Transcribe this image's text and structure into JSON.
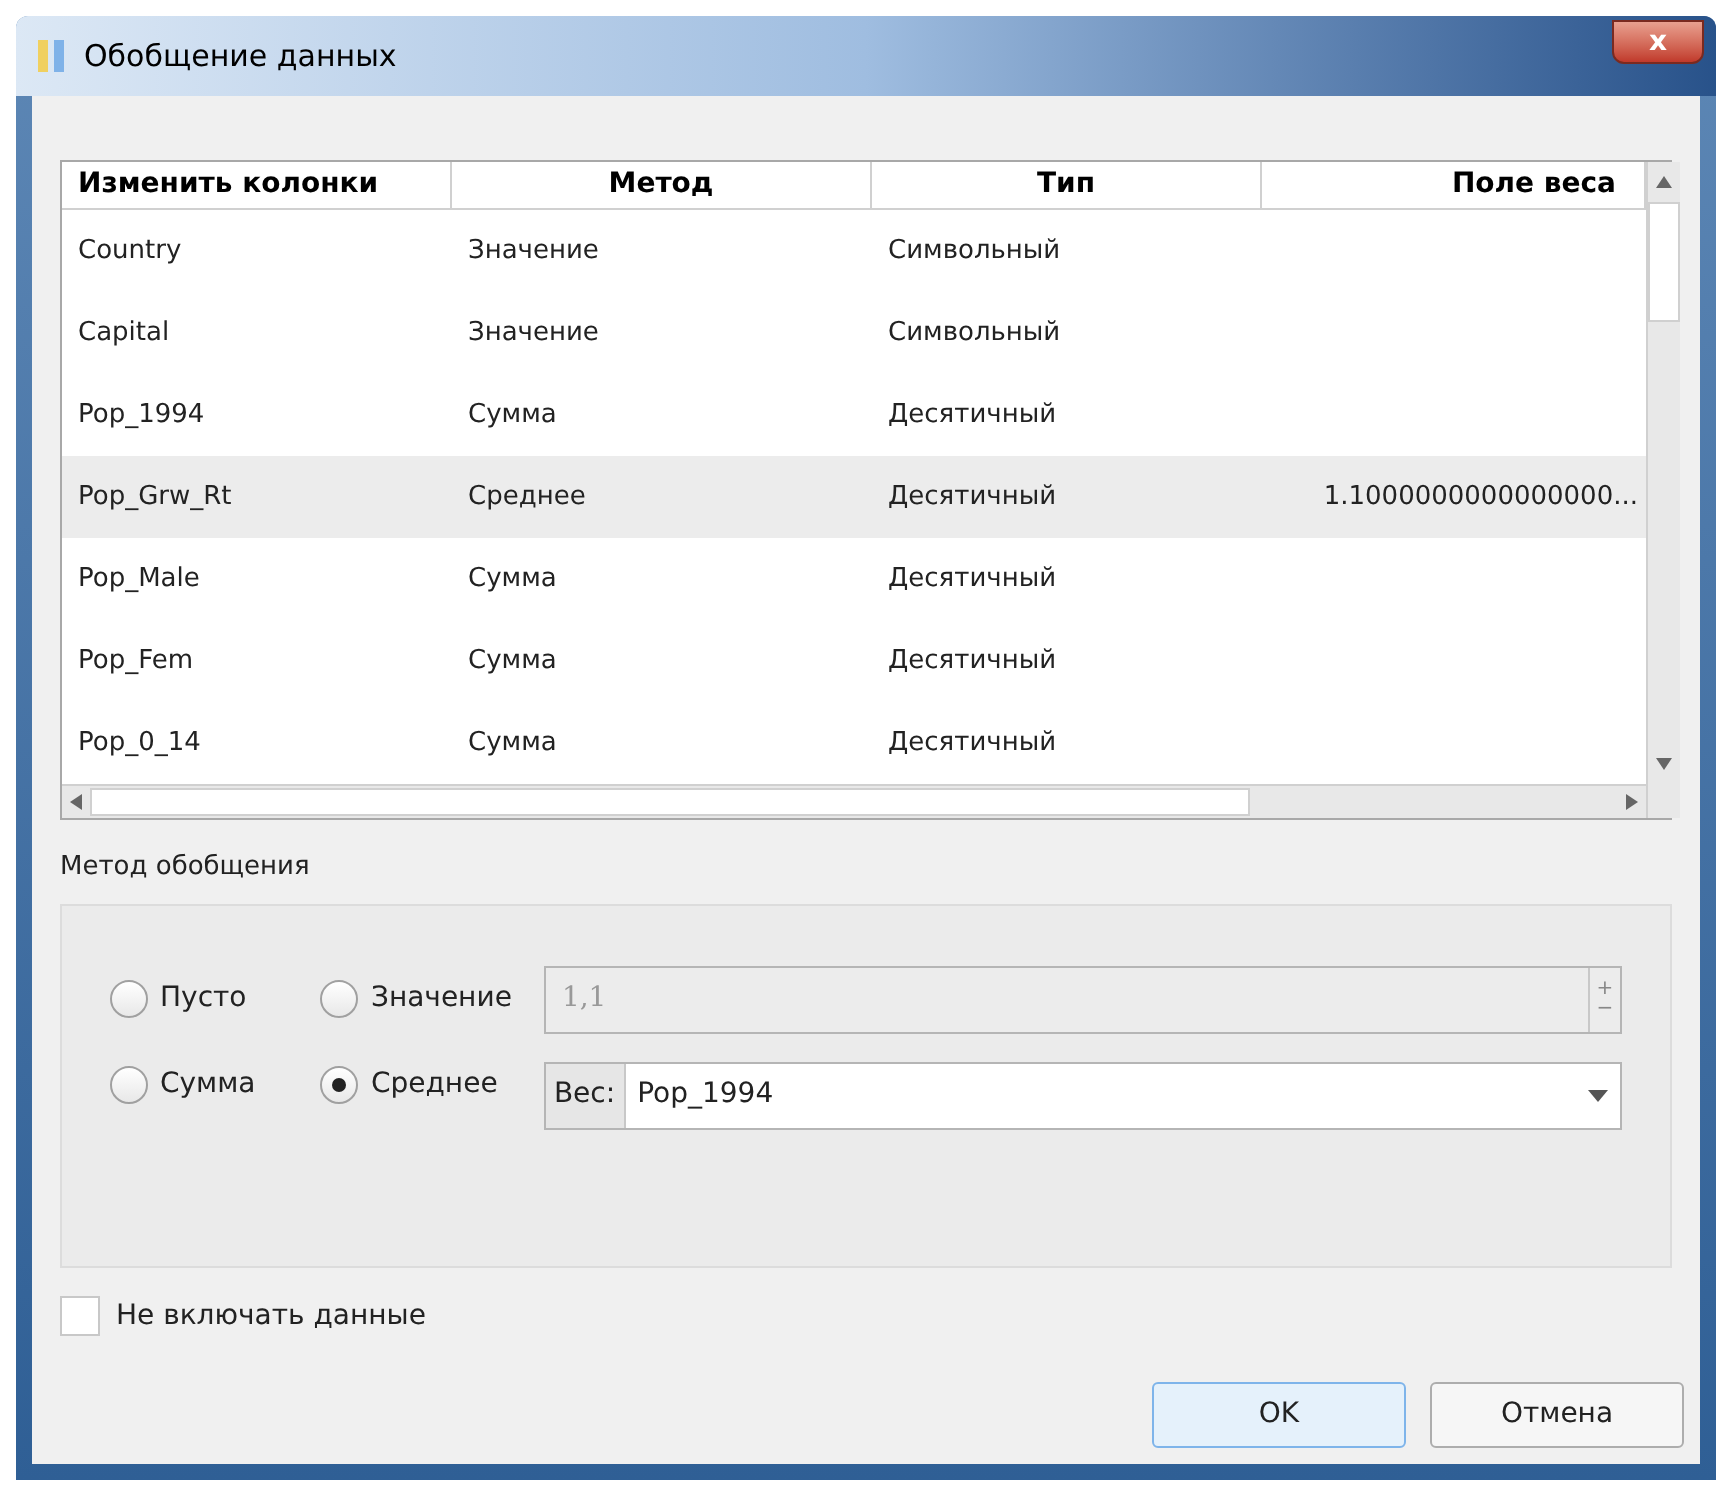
{
  "window": {
    "title": "Обобщение данных",
    "close": "x"
  },
  "table": {
    "columns": [
      "Изменить колонки",
      "Метод",
      "Тип",
      "Поле веса"
    ],
    "rows": [
      {
        "cells": [
          "Country",
          "Значение",
          "Символьный",
          ""
        ],
        "selected": false
      },
      {
        "cells": [
          "Capital",
          "Значение",
          "Символьный",
          ""
        ],
        "selected": false
      },
      {
        "cells": [
          "Pop_1994",
          "Сумма",
          "Десятичный",
          ""
        ],
        "selected": false
      },
      {
        "cells": [
          "Pop_Grw_Rt",
          "Среднее",
          "Десятичный",
          "1.1000000000000000..."
        ],
        "selected": true
      },
      {
        "cells": [
          "Pop_Male",
          "Сумма",
          "Десятичный",
          ""
        ],
        "selected": false
      },
      {
        "cells": [
          "Pop_Fem",
          "Сумма",
          "Десятичный",
          ""
        ],
        "selected": false
      },
      {
        "cells": [
          "Pop_0_14",
          "Сумма",
          "Десятичный",
          ""
        ],
        "selected": false
      }
    ]
  },
  "method_group": {
    "title": "Метод обобщения",
    "radios": [
      {
        "label": "Пусто",
        "selected": false
      },
      {
        "label": "Значение",
        "selected": false
      },
      {
        "label": "Сумма",
        "selected": false
      },
      {
        "label": "Среднее",
        "selected": true
      }
    ],
    "value_field": {
      "value": "1,1",
      "disabled": true,
      "plus": "+",
      "minus": "−"
    },
    "weight_label": "Вес:",
    "weight_value": "Pop_1994"
  },
  "exclude_checkbox": {
    "label": "Не включать данные",
    "checked": false
  },
  "buttons": [
    "OK",
    "Отмена"
  ]
}
